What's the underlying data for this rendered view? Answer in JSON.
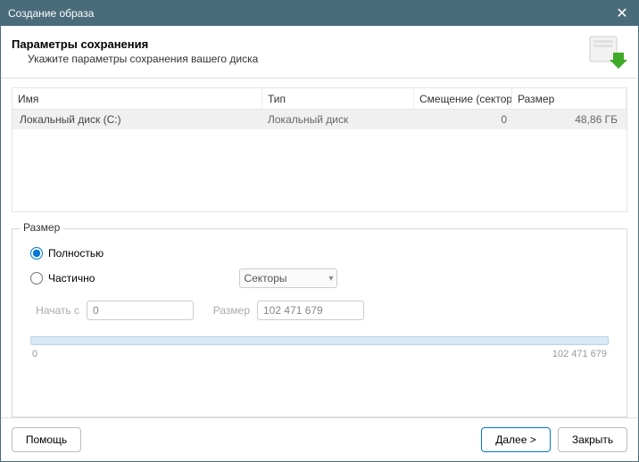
{
  "window": {
    "title": "Создание образа"
  },
  "header": {
    "title": "Параметры сохранения",
    "subtitle": "Укажите параметры сохранения вашего диска"
  },
  "table": {
    "columns": {
      "name": "Имя",
      "type": "Тип",
      "offset": "Смещение (сектор...",
      "size": "Размер"
    },
    "row": {
      "name": "Локальный диск (C:)",
      "type": "Локальный диск",
      "offset": "0",
      "size": "48,86 ГБ"
    }
  },
  "size_group": {
    "legend": "Размер",
    "full": "Полностью",
    "partial": "Частично",
    "unit": "Секторы",
    "start_label": "Начать с",
    "start_value": "0",
    "size_label": "Размер",
    "size_value": "102 471 679",
    "range_min": "0",
    "range_max": "102 471 679"
  },
  "footer": {
    "help": "Помощь",
    "next": "Далее >",
    "close": "Закрыть"
  }
}
